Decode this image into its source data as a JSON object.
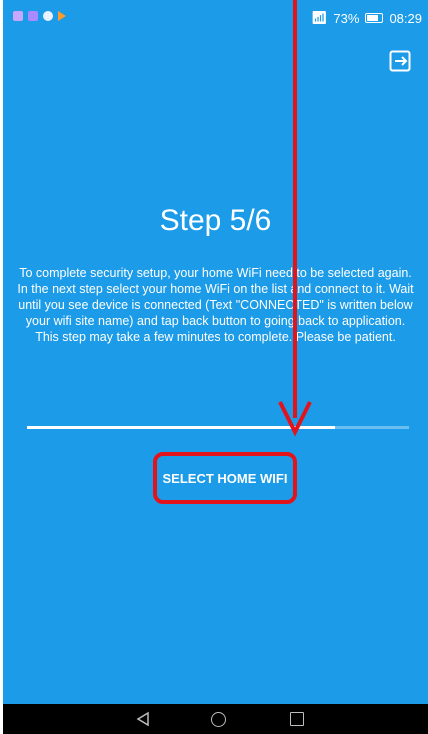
{
  "status_bar": {
    "battery_percent": "73%",
    "time": "08:29",
    "battery_level": 0.73
  },
  "step": {
    "title": "Step 5/6",
    "description_lines": [
      "To complete security setup, your home WiFi need to be selected again.",
      "In the next step select your home WiFi on the list and connect to it. Wait until you see device is connected (Text \"CONNECTED\" is written below your wifi site name) and tap back button to going back to application.",
      "This step may take a few minutes to complete. Please be patient."
    ]
  },
  "progress": {
    "value": 0.805
  },
  "actions": {
    "select_wifi_label": "SELECT HOME WIFI"
  },
  "icons": {
    "logout": "logout-icon",
    "wifi": "wifi-icon",
    "battery": "battery-icon",
    "nav_back": "back-triangle-icon",
    "nav_home": "home-circle-icon",
    "nav_recent": "recent-square-icon"
  },
  "colors": {
    "background": "#1b9be8",
    "text": "#ffffff",
    "annotation": "#e3131b",
    "nav_bar": "#000000"
  }
}
